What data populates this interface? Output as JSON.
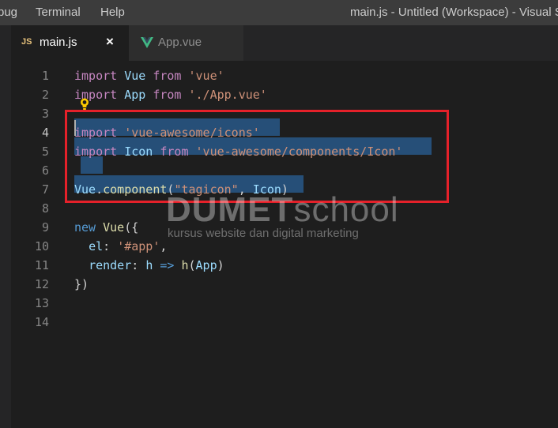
{
  "menubar": {
    "items": [
      "bug",
      "Terminal",
      "Help"
    ]
  },
  "window": {
    "title": "main.js - Untitled (Workspace) - Visual S"
  },
  "tabs": [
    {
      "icon_text": "JS",
      "label": "main.js",
      "close": "×",
      "active": true
    },
    {
      "label": "App.vue",
      "active": false
    }
  ],
  "editor": {
    "lines": [
      {
        "number": "1",
        "tokens": [
          [
            "kw",
            "import"
          ],
          [
            "pl",
            " "
          ],
          [
            "id",
            "Vue"
          ],
          [
            "pl",
            " "
          ],
          [
            "kw",
            "from"
          ],
          [
            "pl",
            " "
          ],
          [
            "str",
            "'vue'"
          ]
        ]
      },
      {
        "number": "2",
        "tokens": [
          [
            "kw",
            "import"
          ],
          [
            "pl",
            " "
          ],
          [
            "id",
            "App"
          ],
          [
            "pl",
            " "
          ],
          [
            "kw",
            "from"
          ],
          [
            "pl",
            " "
          ],
          [
            "str",
            "'./App.vue'"
          ]
        ]
      },
      {
        "number": "3",
        "tokens": []
      },
      {
        "number": "4",
        "tokens": [
          [
            "kw",
            "import"
          ],
          [
            "pl",
            " "
          ],
          [
            "str",
            "'vue-awesome/icons'"
          ]
        ]
      },
      {
        "number": "5",
        "tokens": [
          [
            "kw",
            "import"
          ],
          [
            "pl",
            " "
          ],
          [
            "id",
            "Icon"
          ],
          [
            "pl",
            " "
          ],
          [
            "kw",
            "from"
          ],
          [
            "pl",
            " "
          ],
          [
            "str",
            "'vue-awesome/components/Icon'"
          ]
        ]
      },
      {
        "number": "6",
        "tokens": []
      },
      {
        "number": "7",
        "tokens": [
          [
            "id",
            "Vue"
          ],
          [
            "pl",
            "."
          ],
          [
            "fn",
            "component"
          ],
          [
            "pl",
            "("
          ],
          [
            "str",
            "\"tagicon\""
          ],
          [
            "pl",
            ", "
          ],
          [
            "id",
            "Icon"
          ],
          [
            "pl",
            ")"
          ]
        ]
      },
      {
        "number": "8",
        "tokens": []
      },
      {
        "number": "9",
        "tokens": [
          [
            "st",
            "new"
          ],
          [
            "pl",
            " "
          ],
          [
            "fn",
            "Vue"
          ],
          [
            "pl",
            "({"
          ]
        ]
      },
      {
        "number": "10",
        "tokens": [
          [
            "pl",
            "  "
          ],
          [
            "id",
            "el"
          ],
          [
            "pl",
            ": "
          ],
          [
            "str",
            "'#app'"
          ],
          [
            "pl",
            ","
          ]
        ]
      },
      {
        "number": "11",
        "tokens": [
          [
            "pl",
            "  "
          ],
          [
            "id",
            "render"
          ],
          [
            "pl",
            ": "
          ],
          [
            "id",
            "h"
          ],
          [
            "pl",
            " "
          ],
          [
            "st",
            "=>"
          ],
          [
            "pl",
            " "
          ],
          [
            "fn",
            "h"
          ],
          [
            "pl",
            "("
          ],
          [
            "id",
            "App"
          ],
          [
            "pl",
            ")"
          ]
        ]
      },
      {
        "number": "12",
        "tokens": [
          [
            "pl",
            "})"
          ]
        ]
      },
      {
        "number": "13",
        "tokens": []
      },
      {
        "number": "14",
        "tokens": []
      }
    ]
  },
  "watermark": {
    "brand": "DUMET",
    "brand_suffix": "school",
    "tagline": "kursus website dan digital marketing"
  },
  "colors": {
    "highlight_box": "#e5212a",
    "selection": "#264f78",
    "vue_green": "#41b883"
  }
}
